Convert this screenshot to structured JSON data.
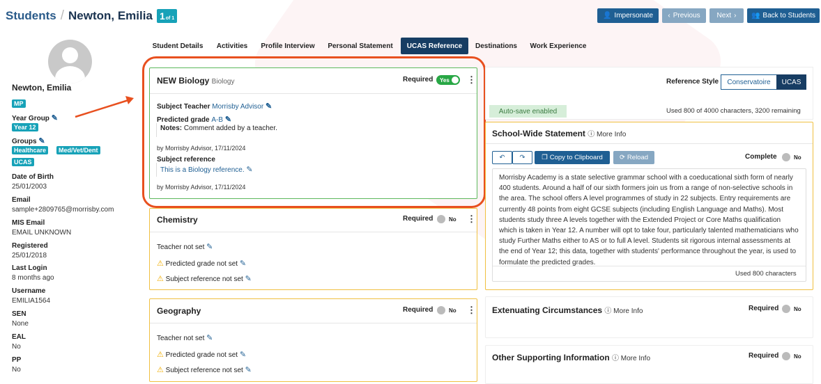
{
  "breadcrumb": {
    "root": "Students",
    "separator": "/",
    "current": "Newton, Emilia",
    "page_num": "1",
    "page_of": "of 1"
  },
  "header_buttons": {
    "impersonate": "Impersonate",
    "previous": "Previous",
    "next": "Next",
    "back": "Back to Students"
  },
  "student": {
    "name": "Newton, Emilia",
    "initials_tag": "MP",
    "year_group_label": "Year Group",
    "year_group": "Year 12",
    "groups_label": "Groups",
    "groups": [
      "Healthcare",
      "Med/Vet/Dent",
      "UCAS"
    ],
    "fields": [
      {
        "label": "Date of Birth",
        "value": "25/01/2003"
      },
      {
        "label": "Email",
        "value": "sample+2809765@morrisby.com"
      },
      {
        "label": "MIS Email",
        "value": "EMAIL UNKNOWN"
      },
      {
        "label": "Registered",
        "value": "25/01/2018"
      },
      {
        "label": "Last Login",
        "value": "8 months ago"
      },
      {
        "label": "Username",
        "value": "EMILIA1564"
      },
      {
        "label": "SEN",
        "value": "None"
      },
      {
        "label": "EAL",
        "value": "No"
      },
      {
        "label": "PP",
        "value": "No"
      }
    ]
  },
  "tabs": [
    "Student Details",
    "Activities",
    "Profile Interview",
    "Personal Statement",
    "UCAS Reference",
    "Destinations",
    "Work Experience"
  ],
  "active_tab": "UCAS Reference",
  "subjects": [
    {
      "title": "NEW Biology",
      "subtitle": "Biology",
      "required_label": "Required",
      "required": "Yes",
      "teacher_label": "Subject Teacher",
      "teacher": "Morrisby Advisor",
      "grade_label": "Predicted grade",
      "grade": "A-B",
      "notes_label": "Notes:",
      "notes": "Comment added by a teacher.",
      "grade_by": "by Morrisby Advisor, 17/11/2024",
      "ref_label": "Subject reference",
      "ref": "This is a Biology reference.",
      "ref_by": "by Morrisby Advisor, 17/11/2024"
    },
    {
      "title": "Chemistry",
      "required_label": "Required",
      "required": "No",
      "teacher": "Teacher not set",
      "grade": "Predicted grade not set",
      "ref": "Subject reference not set"
    },
    {
      "title": "Geography",
      "required_label": "Required",
      "required": "No",
      "teacher": "Teacher not set",
      "grade": "Predicted grade not set",
      "ref": "Subject reference not set"
    }
  ],
  "reference_style": {
    "label": "Reference Style",
    "options": [
      "Conservatoire",
      "UCAS"
    ],
    "selected": "UCAS"
  },
  "autosave": "Auto-save enabled",
  "char_count": "Used 800 of 4000 characters, 3200 remaining",
  "school_statement": {
    "title": "School-Wide Statement",
    "more_info": "More Info",
    "copy": "Copy to Clipboard",
    "reload": "Reload",
    "complete_label": "Complete",
    "complete": "No",
    "text": "Morrisby Academy is a state selective grammar school with a coeducational sixth form of nearly 400 students. Around a half of our sixth formers join us from a range of non-selective schools in the area. The school offers A level programmes of study in 22 subjects. Entry requirements are currently 48 points from eight GCSE subjects (including English Language and Maths). Most students study three A levels together with the Extended Project or Core Maths qualification which is taken in Year 12. A number will opt to take four, particularly talented mathematicians who study Further Maths either to AS or to full A level. Students sit rigorous internal assessments at the end of Year 12; this data, together with students' performance throughout the year, is used to formulate the predicted grades.",
    "used": "Used 800 characters"
  },
  "extenuating": {
    "title": "Extenuating Circumstances",
    "more_info": "More Info",
    "required_label": "Required",
    "required": "No"
  },
  "other_info": {
    "title": "Other Supporting Information",
    "more_info": "More Info",
    "required_label": "Required",
    "required": "No"
  },
  "colors": {
    "primary": "#1f5f93",
    "nav_dark": "#173d63",
    "tag": "#17a2b8",
    "success": "#28a745",
    "warning_border": "#f0c040",
    "annotation": "#e8501f"
  }
}
